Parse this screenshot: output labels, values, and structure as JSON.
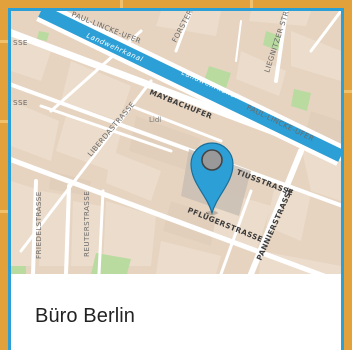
{
  "card": {
    "title": "Büro Berlin"
  },
  "map": {
    "streets": {
      "paul_lincke_ufer_top": "PAUL-LINCKE-UFER",
      "forster": "FORSTER",
      "liegnitzer": "LIEGNITZER STR",
      "sse_top": "SSE",
      "sse_mid": "SSE",
      "maybachufer": "MAYBACHUFER",
      "paul_lincke_ufer_right": "PAUL-LINCKE-UFER",
      "liberdastrasse": "LIBERDASTRASSE",
      "friedelstrasse": "FRIEDELSTRASSE",
      "reuterstrasse": "REUTERSTRASSE",
      "weichselstrasse": "ASTRASSE",
      "tiusstrasse": "TIUSSTRASSE",
      "pflugerstrasse": "PFLÜGERSTRASSE",
      "pannierstrasse": "PANNIERSTRASSE"
    },
    "water": {
      "canal_top": "Landwehrkanal",
      "canal_mid": "Landwehrkanal"
    },
    "poi": {
      "lidl": "Lidl"
    },
    "colors": {
      "marker": "#2c9fd6",
      "water": "#2c9fd6",
      "park": "#b9dba0",
      "block": "#ead9c7",
      "street": "#ffffff",
      "frame": "#2c9fd6"
    },
    "marker_icon": "map-pin-icon"
  }
}
